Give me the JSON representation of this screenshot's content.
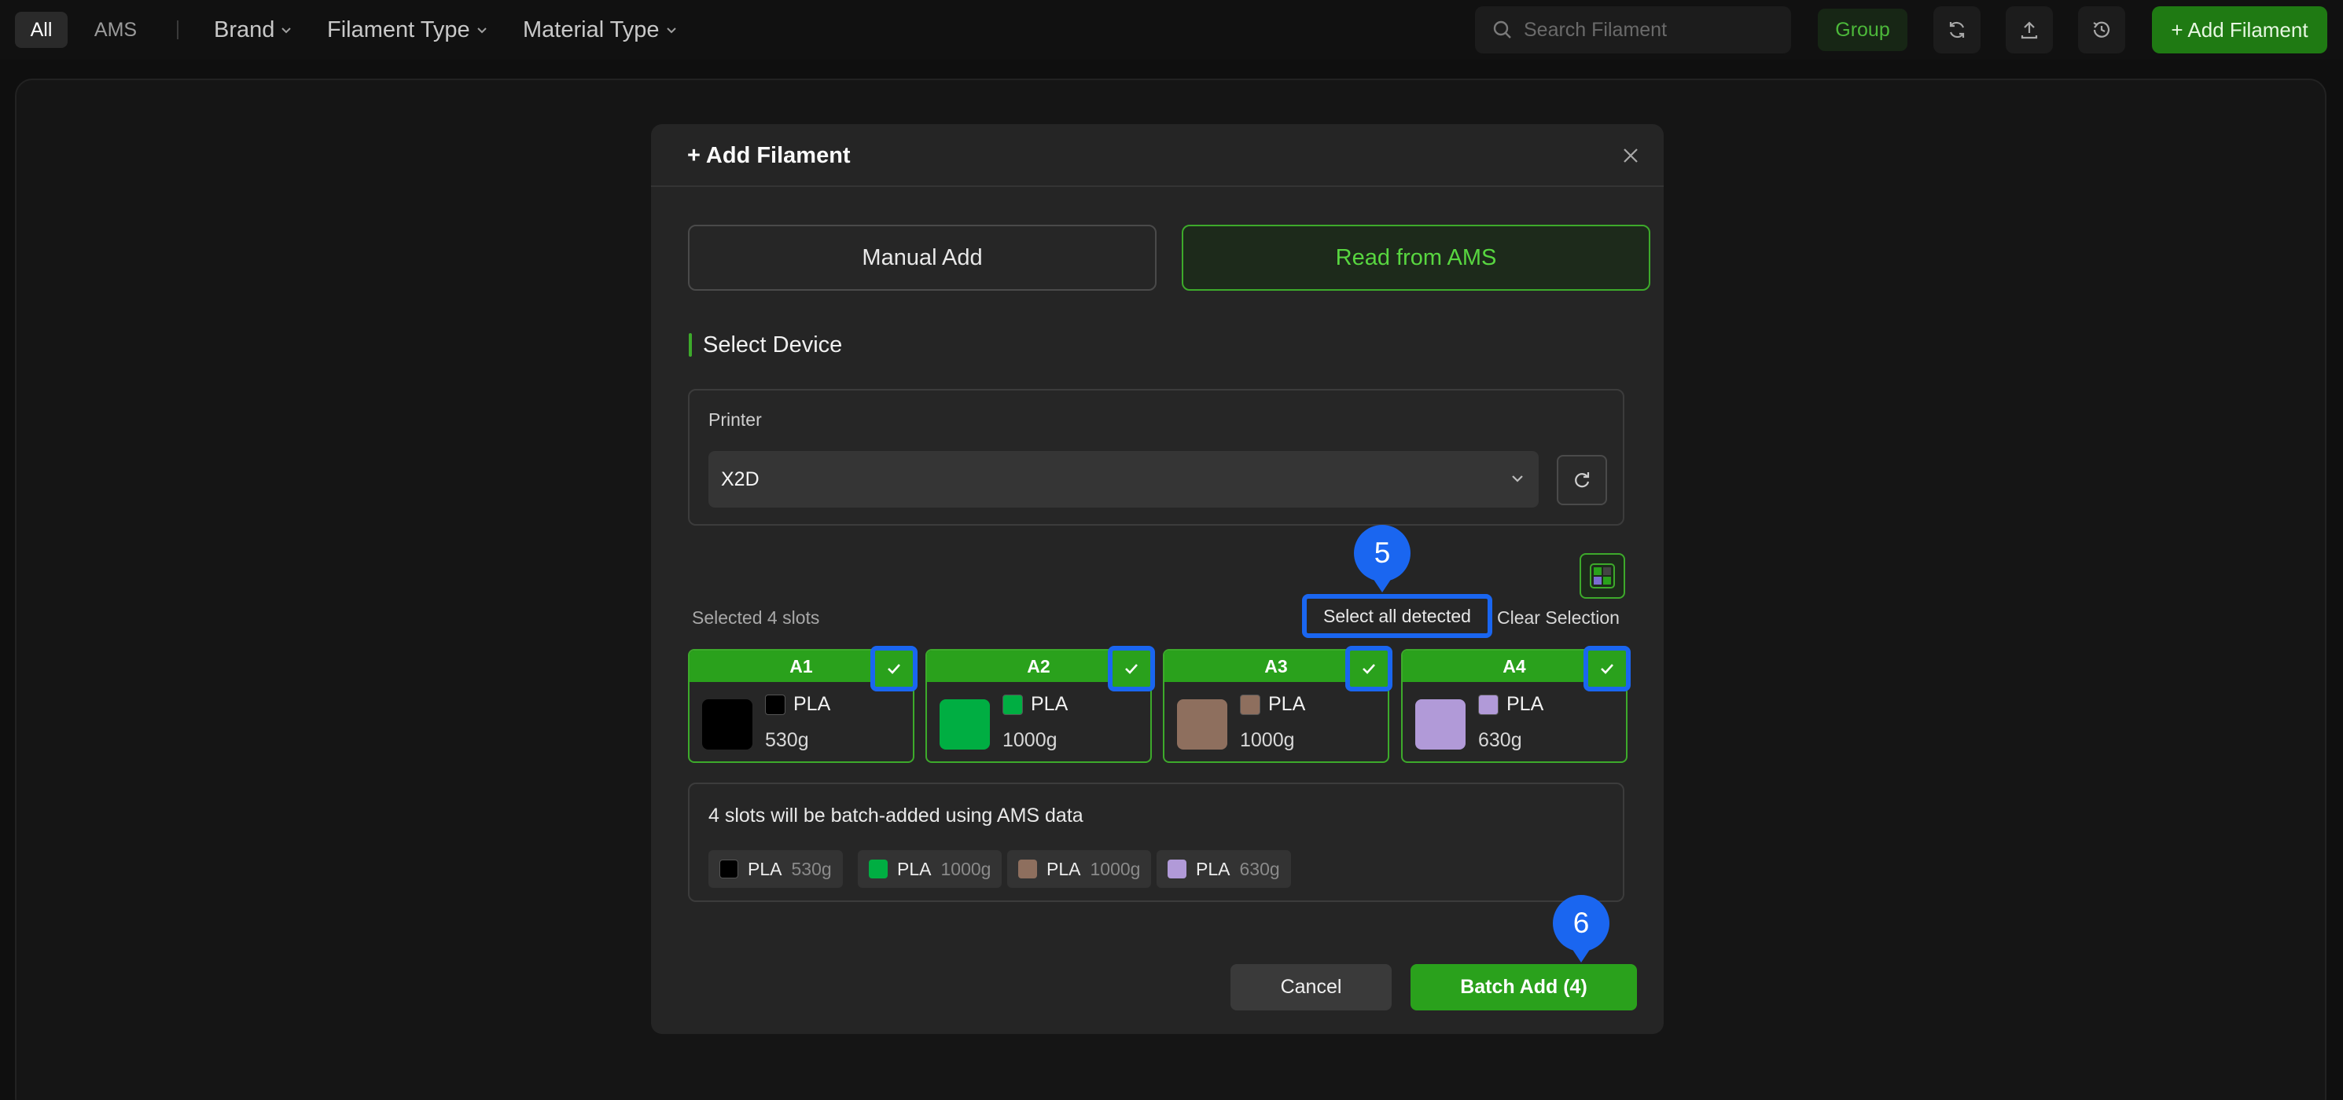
{
  "topbar": {
    "tabs": [
      {
        "label": "All",
        "active": true
      },
      {
        "label": "AMS",
        "active": false
      }
    ],
    "filters": [
      {
        "label": "Brand",
        "icon": "chevron-down-icon"
      },
      {
        "label": "Filament Type",
        "icon": "chevron-down-icon"
      },
      {
        "label": "Material Type",
        "icon": "chevron-down-icon"
      }
    ],
    "search": {
      "placeholder": "Search Filament",
      "value": "",
      "icon": "search-icon"
    },
    "group_label": "Group",
    "icon_buttons": [
      "sync-icon",
      "upload-icon",
      "history-icon"
    ],
    "add_label": "+ Add Filament"
  },
  "modal": {
    "title": "+ Add Filament",
    "close_icon": "close-icon",
    "modes": [
      {
        "label": "Manual Add",
        "active": false
      },
      {
        "label": "Read from AMS",
        "active": true
      }
    ],
    "section_title": "Select Device",
    "printer": {
      "label": "Printer",
      "selected": "X2D",
      "refresh_icon": "refresh-icon"
    },
    "grid_toggle_icon": "grid-icon",
    "selected_count_text": "Selected 4 slots",
    "select_all_label": "Select all detected",
    "clear_selection_label": "Clear Selection",
    "slots": [
      {
        "id": "A1",
        "type": "PLA",
        "weight": "530g",
        "color": "#000000",
        "checked": true
      },
      {
        "id": "A2",
        "type": "PLA",
        "weight": "1000g",
        "color": "#00ae42",
        "checked": true
      },
      {
        "id": "A3",
        "type": "PLA",
        "weight": "1000g",
        "color": "#8e6f5e",
        "checked": true
      },
      {
        "id": "A4",
        "type": "PLA",
        "weight": "630g",
        "color": "#b19ad8",
        "checked": true
      }
    ],
    "summary": {
      "text": "4 slots will be batch-added using AMS data",
      "chips": [
        {
          "type": "PLA",
          "weight": "530g",
          "color": "#000000"
        },
        {
          "type": "PLA",
          "weight": "1000g",
          "color": "#00ae42"
        },
        {
          "type": "PLA",
          "weight": "1000g",
          "color": "#8e6f5e"
        },
        {
          "type": "PLA",
          "weight": "630g",
          "color": "#b19ad8"
        }
      ]
    },
    "cancel_label": "Cancel",
    "batch_label": "Batch Add (4)"
  },
  "annotations": [
    {
      "number": "5"
    },
    {
      "number": "6"
    }
  ],
  "colors": {
    "accent": "#2aa11c",
    "accent_text": "#58d640",
    "highlight": "#1a66f0",
    "background": "#0f0f0f",
    "modal_bg": "#252525"
  }
}
